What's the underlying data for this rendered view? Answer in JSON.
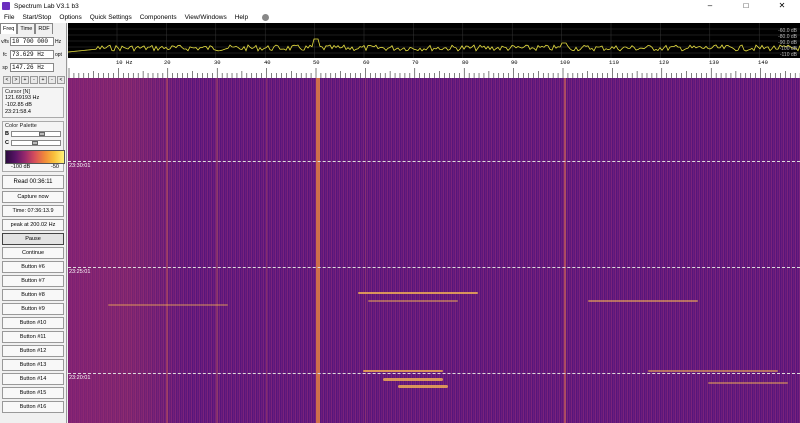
{
  "window": {
    "title": "Spectrum Lab V3.1 b3",
    "controls": [
      "–",
      "□",
      "✕"
    ]
  },
  "menu": [
    "File",
    "Start/Stop",
    "Options",
    "Quick Settings",
    "Components",
    "View/Windows",
    "Help"
  ],
  "left_panel": {
    "tabs": [
      "Freq",
      "Time",
      "RDF"
    ],
    "active_tab": "Freq",
    "freq_fields": [
      {
        "label": "v/fs",
        "value": "10 700 000",
        "unit": "Hz"
      },
      {
        "label": "fc",
        "value": "73.629 Hz",
        "unit": "opt"
      },
      {
        "label": "sp",
        "value": "147.26 Hz",
        "unit": ""
      }
    ],
    "arrow_buttons": [
      "<",
      ">",
      "+",
      "-",
      "+",
      "-",
      "<",
      ">"
    ],
    "cursor": {
      "title": "Cursor [N]",
      "freq": "121.69193 Hz",
      "level": "-102.85 dB",
      "time": "23:21:58.4"
    },
    "palette": {
      "title": "Color Palette",
      "b_label": "B",
      "c_label": "C",
      "b_level": 0.6,
      "c_level": 0.45,
      "min_label": "-100 dB",
      "max_label": "-50"
    },
    "buttons": [
      {
        "label": "Read 00:36:11",
        "size": "big"
      },
      {
        "label": "Capture now",
        "size": "normal"
      },
      {
        "label": "Time:  07:36:13.9",
        "size": "normal"
      },
      {
        "label": "peak at 200.02 Hz",
        "size": "normal"
      },
      {
        "label": "Pause",
        "size": "normal",
        "pressed": true
      },
      {
        "label": "Continue",
        "size": "normal"
      },
      {
        "label": "Button #6",
        "size": "normal"
      },
      {
        "label": "Button #7",
        "size": "normal"
      },
      {
        "label": "Button #8",
        "size": "normal"
      },
      {
        "label": "Button #9",
        "size": "normal"
      },
      {
        "label": "Button #10",
        "size": "normal"
      },
      {
        "label": "Button #11",
        "size": "normal"
      },
      {
        "label": "Button #12",
        "size": "normal"
      },
      {
        "label": "Button #13",
        "size": "normal"
      },
      {
        "label": "Button #14",
        "size": "normal"
      },
      {
        "label": "Button #15",
        "size": "normal"
      },
      {
        "label": "Button #16",
        "size": "normal"
      }
    ]
  },
  "spectrum": {
    "db_labels": [
      "-60.0 dB",
      "-80.0 dB",
      "-90.0 dB",
      "-100 dB",
      "-110 dB"
    ],
    "line_color": "#e8e040"
  },
  "axis": {
    "ticks": [
      "10 Hz",
      "20",
      "30",
      "40",
      "50",
      "60",
      "70",
      "80",
      "90",
      "100",
      "110",
      "120",
      "130",
      "140"
    ]
  },
  "waterfall": {
    "time_labels": [
      "23:30:01",
      "23:25:01",
      "23:20:01"
    ]
  },
  "colors": {
    "panel_bg": "#f0f0f0",
    "waterfall_base": "#58177a",
    "hot": "#f5a640"
  }
}
